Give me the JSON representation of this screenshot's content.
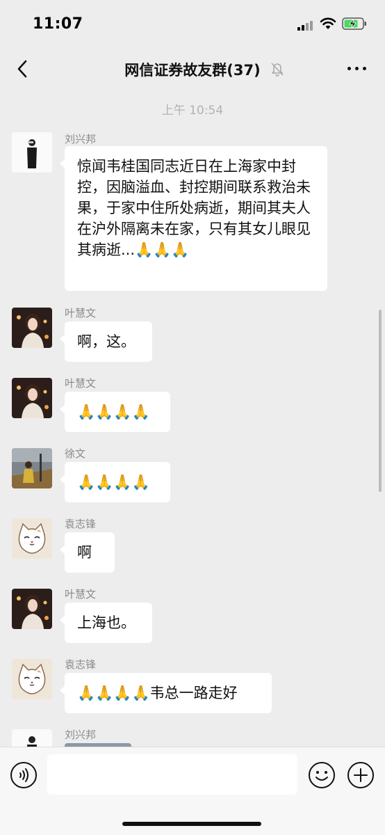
{
  "status_bar": {
    "time": "11:07"
  },
  "nav": {
    "title": "网信证券故友群(37)"
  },
  "timestamp": "上午 10:54",
  "messages": [
    {
      "sender": "刘兴邦",
      "text": "惊闻韦桂国同志近日在上海家中封控，因脑溢血、封控期间联系救治未果，于家中住所处病逝，期间其夫人在沪外隔离未在家，只有其女儿眼见其病逝...🙏🙏🙏"
    },
    {
      "sender": "叶慧文",
      "text": "啊，这。"
    },
    {
      "sender": "叶慧文",
      "text": "🙏🙏🙏🙏"
    },
    {
      "sender": "徐文",
      "text": "🙏🙏🙏🙏"
    },
    {
      "sender": "袁志锋",
      "text": "啊"
    },
    {
      "sender": "叶慧文",
      "text": "上海也。"
    },
    {
      "sender": "袁志锋",
      "text": "🙏🙏🙏🙏韦总一路走好"
    },
    {
      "sender": "刘兴邦",
      "text": ""
    }
  ],
  "input": {
    "placeholder": ""
  },
  "icons": [
    "back-chevron-icon",
    "mute-bell-icon",
    "more-dots-icon",
    "voice-icon",
    "emoji-icon",
    "plus-icon"
  ]
}
